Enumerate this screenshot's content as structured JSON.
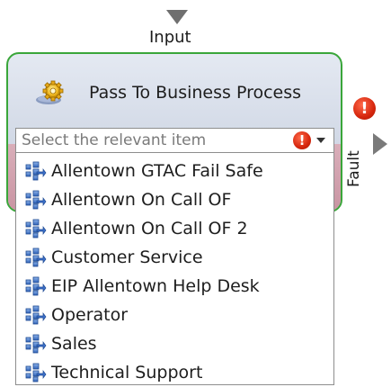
{
  "connectors": {
    "input_label": "Input",
    "fault_label": "Fault",
    "fault_badge": "!"
  },
  "node": {
    "title": "Pass To Business Process",
    "icon": "gear-icon",
    "border_color": "#3aa63a"
  },
  "combo": {
    "placeholder": "Select the relevant item",
    "value": "",
    "warning_badge": "!"
  },
  "list": {
    "item_icon": "business-process-icon",
    "items": [
      {
        "label": "Allentown GTAC Fail Safe"
      },
      {
        "label": "Allentown On Call OF"
      },
      {
        "label": "Allentown On Call OF 2"
      },
      {
        "label": "Customer Service"
      },
      {
        "label": "EIP Allentown Help Desk"
      },
      {
        "label": "Operator"
      },
      {
        "label": "Sales"
      },
      {
        "label": "Technical Support"
      }
    ]
  }
}
